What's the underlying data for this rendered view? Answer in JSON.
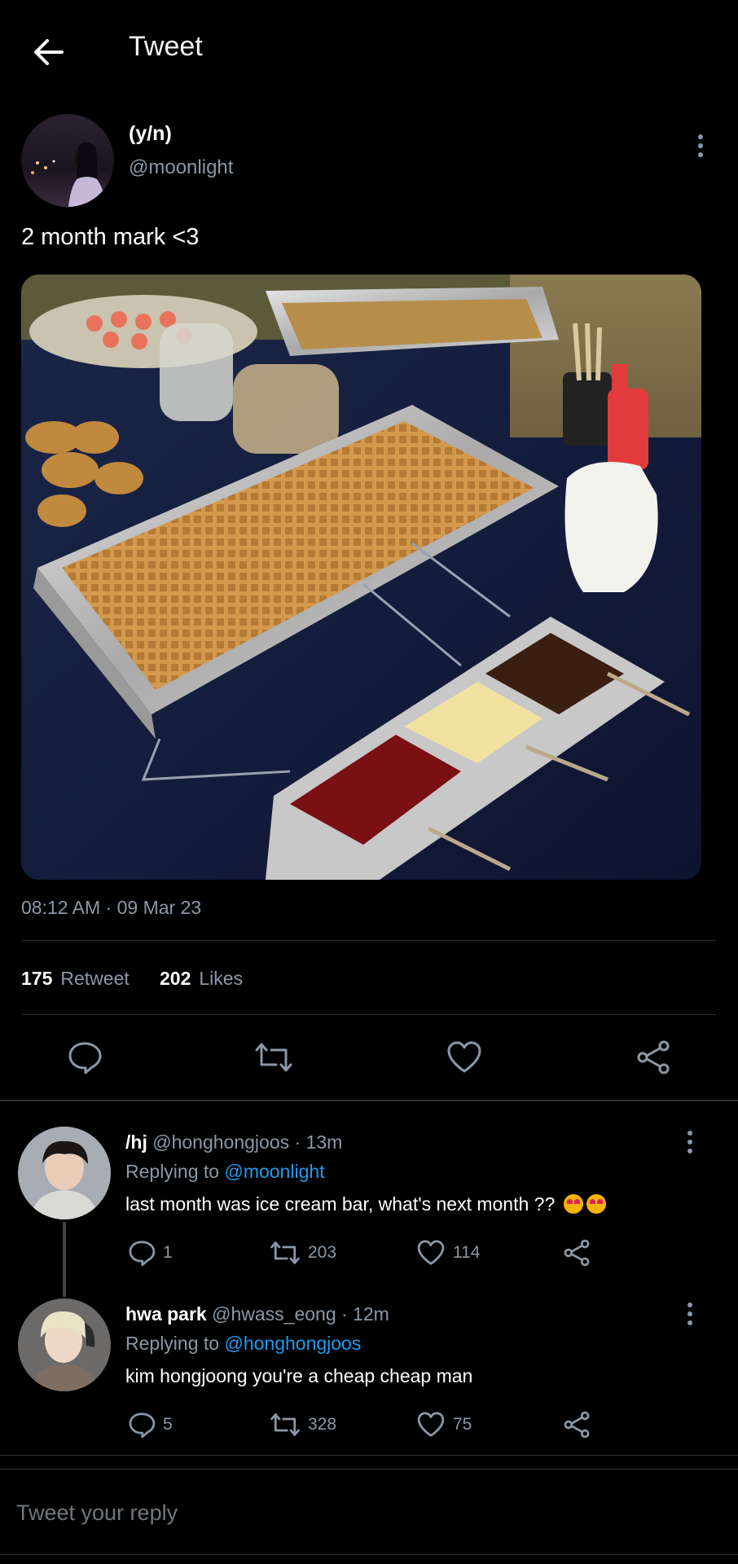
{
  "header": {
    "title": "Tweet"
  },
  "tweet": {
    "display_name": "(y/n)",
    "handle": "@moonlight",
    "text": "2 month mark <3",
    "timestamp": "08:12 AM · 09 Mar 23",
    "retweet_count": "175",
    "retweet_label": "Retweet",
    "likes_count": "202",
    "likes_label": "Likes"
  },
  "replies": [
    {
      "display_name": "/hj",
      "handle_time": "@honghongjoos · 13m",
      "replying_prefix": "Replying to",
      "replying_to": "@moonlight",
      "text": "last month was ice cream bar, what's next month ??",
      "emoji": "star-struck-emoji",
      "replies": "1",
      "retweets": "203",
      "likes": "114"
    },
    {
      "display_name": "hwa park",
      "handle_time": "@hwass_eong · 12m",
      "replying_prefix": "Replying to",
      "replying_to": "@honghongjoos",
      "text": "kim hongjoong you're a cheap cheap man",
      "replies": "5",
      "retweets": "328",
      "likes": "75"
    }
  ],
  "composer": {
    "placeholder": "Tweet your reply"
  },
  "colors": {
    "background": "#000000",
    "muted": "#8b98a5",
    "link": "#1d9bf0",
    "divider": "#2f3336"
  }
}
